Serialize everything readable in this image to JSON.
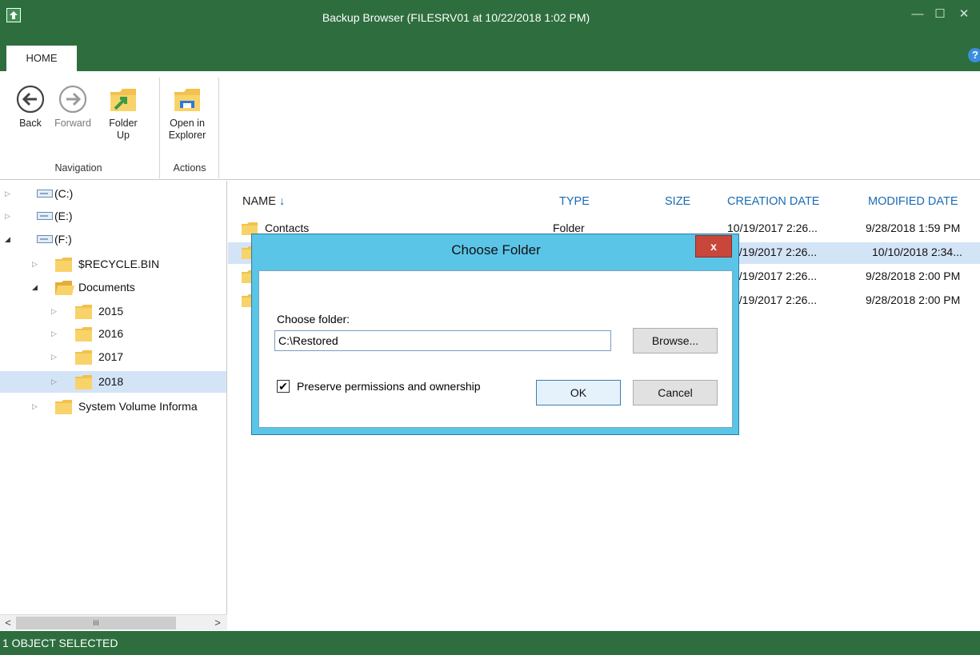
{
  "window": {
    "title": "Backup Browser (FILESRV01 at 10/22/2018 1:02 PM)",
    "controls": {
      "minimize": "—",
      "maximize": "☐",
      "close": "✕"
    }
  },
  "ribbon": {
    "tab": "HOME",
    "help": "?",
    "buttons": {
      "back": "Back",
      "forward": "Forward",
      "folder_up_1": "Folder",
      "folder_up_2": "Up",
      "open_in_1": "Open in",
      "open_in_2": "Explorer"
    },
    "groups": {
      "navigation": "Navigation",
      "actions": "Actions"
    }
  },
  "tree": {
    "nodes": [
      {
        "label": "(C:)",
        "icon": "drive-icon"
      },
      {
        "label": "(E:)",
        "icon": "drive-icon"
      },
      {
        "label": "(F:)",
        "icon": "drive-icon"
      },
      {
        "label": "$RECYCLE.BIN",
        "icon": "folder-icon"
      },
      {
        "label": "Documents",
        "icon": "folder-open-icon"
      },
      {
        "label": "2015",
        "icon": "folder-icon"
      },
      {
        "label": "2016",
        "icon": "folder-icon"
      },
      {
        "label": "2017",
        "icon": "folder-icon"
      },
      {
        "label": "2018",
        "icon": "folder-icon"
      },
      {
        "label": "System Volume Informa",
        "icon": "folder-icon"
      }
    ],
    "scroll_thumb": "III"
  },
  "list": {
    "columns": {
      "name": "NAME",
      "type": "TYPE",
      "size": "SIZE",
      "created": "CREATION DATE",
      "modified": "MODIFIED DATE"
    },
    "sort_indicator": "↓",
    "rows": [
      {
        "name": "Contacts",
        "type": "Folder",
        "created": "10/19/2017 2:26...",
        "modified": "9/28/2018 1:59 PM"
      },
      {
        "name": "",
        "type": "",
        "created": "9/19/2017 2:26...",
        "modified": "10/10/2018 2:34..."
      },
      {
        "name": "",
        "type": "",
        "created": "9/19/2017 2:26...",
        "modified": "9/28/2018 2:00 PM"
      },
      {
        "name": "",
        "type": "",
        "created": "9/19/2017 2:26...",
        "modified": "9/28/2018 2:00 PM"
      }
    ]
  },
  "dialog": {
    "title": "Choose Folder",
    "close": "x",
    "folder_label": "Choose folder:",
    "folder_value": "C:\\Restored",
    "browse": "Browse...",
    "preserve_label": "Preserve permissions and ownership",
    "preserve_checked": true,
    "check_glyph": "✔",
    "ok": "OK",
    "cancel": "Cancel"
  },
  "status": {
    "text": "1 OBJECT SELECTED"
  },
  "colors": {
    "chrome": "#2e6e3e",
    "dialog_frame": "#5bc5e8",
    "selection": "#d4e4f7",
    "header_link": "#1a6bb5",
    "close_red": "#c8473a"
  }
}
